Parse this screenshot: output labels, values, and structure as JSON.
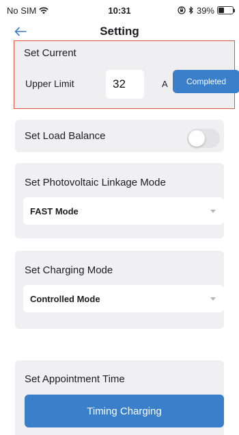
{
  "status_bar": {
    "carrier": "No SIM",
    "time": "10:31",
    "battery": "39%",
    "battery_level": 0.39
  },
  "nav": {
    "title": "Setting"
  },
  "set_current": {
    "title": "Set Current",
    "upper_limit_label": "Upper Limit",
    "value": "32",
    "unit": "A",
    "completed_label": "Completed"
  },
  "load_balance": {
    "title": "Set Load Balance",
    "enabled": false
  },
  "pv_linkage": {
    "title": "Set Photovoltaic Linkage Mode",
    "selected": "FAST Mode"
  },
  "charging_mode": {
    "title": "Set Charging Mode",
    "selected": "Controlled Mode"
  },
  "appointment": {
    "title": "Set Appointment Time",
    "button_label": "Timing Charging"
  },
  "colors": {
    "accent": "#3a7fc9",
    "highlight": "#e0533c",
    "card": "#f0f0f3"
  }
}
